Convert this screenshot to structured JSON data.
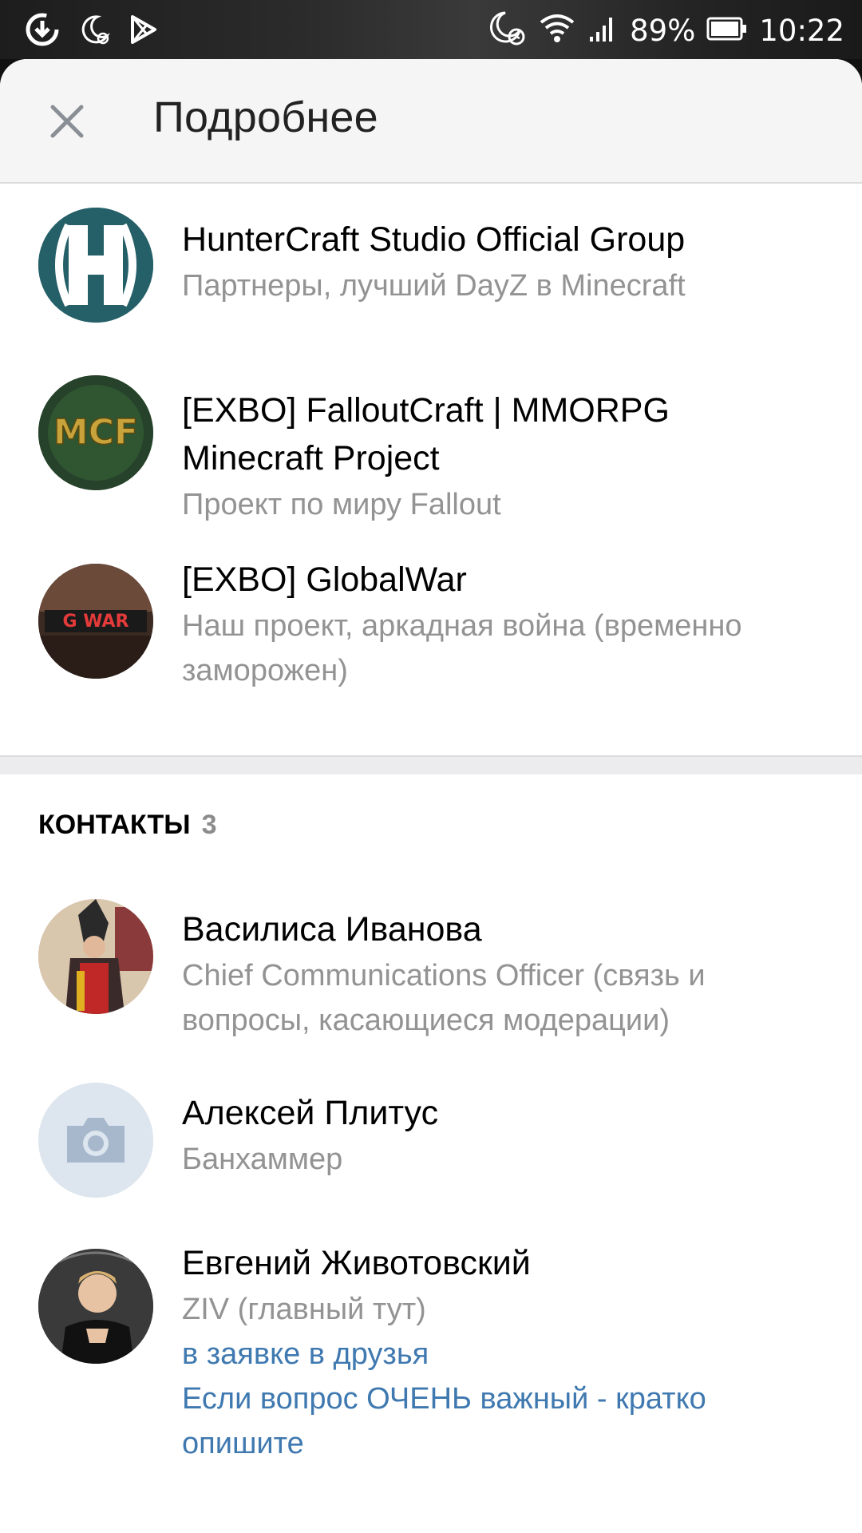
{
  "status_bar": {
    "battery": "89%",
    "time": "10:22",
    "icons": [
      "download-icon",
      "night-mode-icon",
      "play-store-icon",
      "alarm-icon",
      "wifi-icon",
      "signal-icon",
      "battery-icon"
    ]
  },
  "header": {
    "title": "Подробнее",
    "close_icon": "close-icon"
  },
  "groups": [
    {
      "title": "HunterCraft Studio Official Group",
      "subtitle": "Партнеры, лучший DayZ в Minecraft",
      "avatar_text": ""
    },
    {
      "title_line1": "[EXBO] FalloutCraft  | MMORPG",
      "title_line2": "Minecraft Project",
      "subtitle": "Проект по миру Fallout",
      "avatar_text": "MCF"
    },
    {
      "title": "[EXBO] GlobalWar",
      "subtitle_line1": "Наш проект, аркадная война (временно",
      "subtitle_line2": "заморожен)",
      "avatar_text": "G WAR"
    }
  ],
  "contacts": {
    "heading": "КОНТАКТЫ",
    "count": "3",
    "items": [
      {
        "name": "Василиса Иванова",
        "role_line1": "Chief Communications Officer (связь и",
        "role_line2": "вопросы, касающиеся модерации)"
      },
      {
        "name": "Алексей Плитус",
        "role": "Банхаммер"
      },
      {
        "name": "Евгений Животовский",
        "role": "ZIV (главный тут)",
        "link1": "в заявке в друзья",
        "link2_line1": "Если вопрос ОЧЕНЬ важный - кратко",
        "link2_line2": "опишите"
      }
    ]
  },
  "colors": {
    "link": "#3f79b0",
    "secondary_text": "#939393",
    "header_bg": "#f5f5f5"
  }
}
